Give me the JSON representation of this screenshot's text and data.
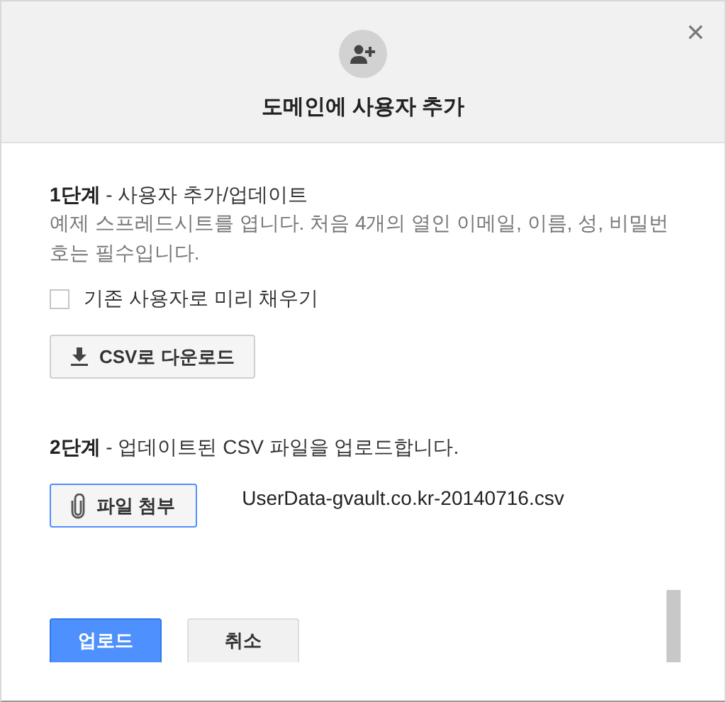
{
  "dialog": {
    "title": "도메인에 사용자 추가",
    "close": "×"
  },
  "steps": [
    {
      "heading": "**1단계** - 사용자 추가/업데이트",
      "description": "예제 스프레드시트를 엽니다. 처음 4개의 열인 이메일, 이름, 성, 비밀번호는 필수입니다.",
      "checkbox": {
        "label": "기존 사용자로 미리 채우기",
        "checked": false
      },
      "button": {
        "label": "CSV로 다운로드",
        "kind": "download"
      }
    },
    {
      "heading": "**2단계** - 업데이트된 CSV 파일을 업로드합니다.",
      "button": {
        "label": "파일 첨부",
        "kind": "attach"
      },
      "file_name": "UserData-gvault.co.kr-20140716.csv"
    }
  ],
  "buttons": [
    {
      "label": "업로드",
      "kind": "primary"
    },
    {
      "label": "취소",
      "kind": "secondary"
    }
  ]
}
